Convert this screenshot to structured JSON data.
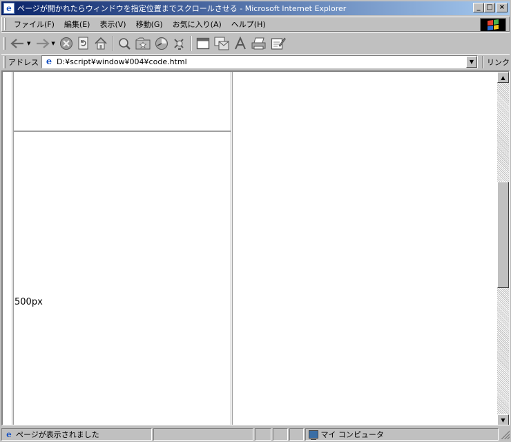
{
  "window": {
    "title": "ページが開かれたらウィンドウを指定位置までスクロールさせる - Microsoft Internet Explorer",
    "minimize_glyph": "_",
    "maximize_glyph": "□",
    "close_glyph": "×"
  },
  "menu": {
    "items": [
      {
        "label": "ファイル(F)"
      },
      {
        "label": "編集(E)"
      },
      {
        "label": "表示(V)"
      },
      {
        "label": "移動(G)"
      },
      {
        "label": "お気に入り(A)"
      },
      {
        "label": "ヘルプ(H)"
      }
    ]
  },
  "toolbar": {
    "icons": [
      "back-icon",
      "forward-icon",
      "stop-icon",
      "refresh-icon",
      "home-icon",
      "search-icon",
      "favorites-icon",
      "history-icon",
      "channels-icon",
      "fullscreen-icon",
      "mail-icon",
      "font-icon",
      "print-icon",
      "edit-icon"
    ]
  },
  "address": {
    "label": "アドレス",
    "url": "D:¥script¥window¥004¥code.html",
    "links_label": "リンク"
  },
  "page": {
    "cell_label": "500px"
  },
  "status": {
    "message": "ページが表示されました",
    "zone": "マイ コンピュータ"
  },
  "colors": {
    "titlebar_start": "#0a246a",
    "titlebar_end": "#a6caf0",
    "chrome": "#c0c0c0"
  }
}
